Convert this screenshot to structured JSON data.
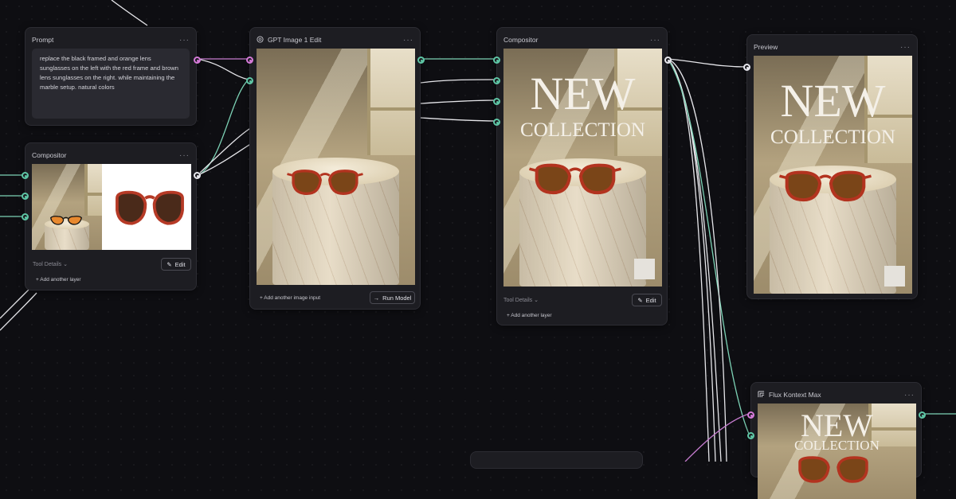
{
  "nodes": {
    "prompt": {
      "title": "Prompt",
      "text": "replace the black framed and orange lens sunglasses on the left with the red frame and brown lens sunglasses on the right. while maintaining the marble setup. natural colors"
    },
    "compositor_left": {
      "title": "Compositor",
      "tool_details": "Tool Details",
      "edit_label": "Edit",
      "add_layer": "+ Add another layer"
    },
    "gpt_edit": {
      "title": "GPT Image 1 Edit",
      "add_input": "Add another image input",
      "run_label": "Run Model"
    },
    "compositor_mid": {
      "title": "Compositor",
      "headline1": "NEW",
      "headline2": "COLLECTION",
      "tool_details": "Tool Details",
      "edit_label": "Edit",
      "add_layer": "+ Add another layer"
    },
    "preview": {
      "title": "Preview",
      "headline1": "NEW",
      "headline2": "COLLECTION"
    },
    "flux": {
      "title": "Flux Kontext Max",
      "headline1": "NEW",
      "headline2": "COLLECTION"
    }
  },
  "icons": {
    "more": "more-dots-icon",
    "openai": "openai-icon",
    "flux": "flux-icon",
    "edit": "pencil-icon",
    "run": "arrow-right-icon",
    "chevron": "chevron-down-icon"
  },
  "colors": {
    "background": "#0e0e12",
    "node": "#1d1d22",
    "wire_white": "#e6e6ea",
    "wire_green": "#7dd3b6",
    "wire_pink": "#c77dd0",
    "port_green": "#5ec6a5",
    "port_pink": "#d57ad8"
  }
}
